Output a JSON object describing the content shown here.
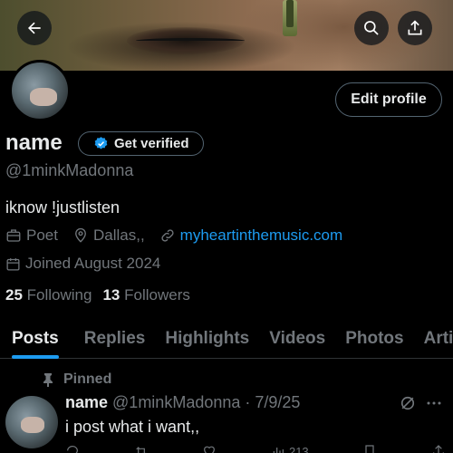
{
  "header": {
    "back_icon": "arrow-left-icon",
    "search_icon": "search-icon",
    "share_icon": "share-icon"
  },
  "profile": {
    "name": "name",
    "verify_label": "Get verified",
    "handle": "@1minkMadonna",
    "bio": "iknow !justlisten",
    "profession": "Poet",
    "location": "Dallas,,",
    "website": "myheartinthemusic.com",
    "joined": "Joined August 2024",
    "following_count": "25",
    "following_label": "Following",
    "followers_count": "13",
    "followers_label": "Followers",
    "edit_label": "Edit profile"
  },
  "tabs": [
    {
      "label": "Posts",
      "active": true
    },
    {
      "label": "Replies",
      "active": false
    },
    {
      "label": "Highlights",
      "active": false
    },
    {
      "label": "Videos",
      "active": false
    },
    {
      "label": "Photos",
      "active": false
    },
    {
      "label": "Artic",
      "active": false
    }
  ],
  "post": {
    "pinned_label": "Pinned",
    "author": "name",
    "handle": "@1minkMadonna",
    "separator": "·",
    "date": "7/9/25",
    "text": "i post what i want,,",
    "views": "213"
  },
  "colors": {
    "accent": "#1d9bf0",
    "text_primary": "#e7e9ea",
    "text_secondary": "#71767b",
    "background": "#000000"
  }
}
